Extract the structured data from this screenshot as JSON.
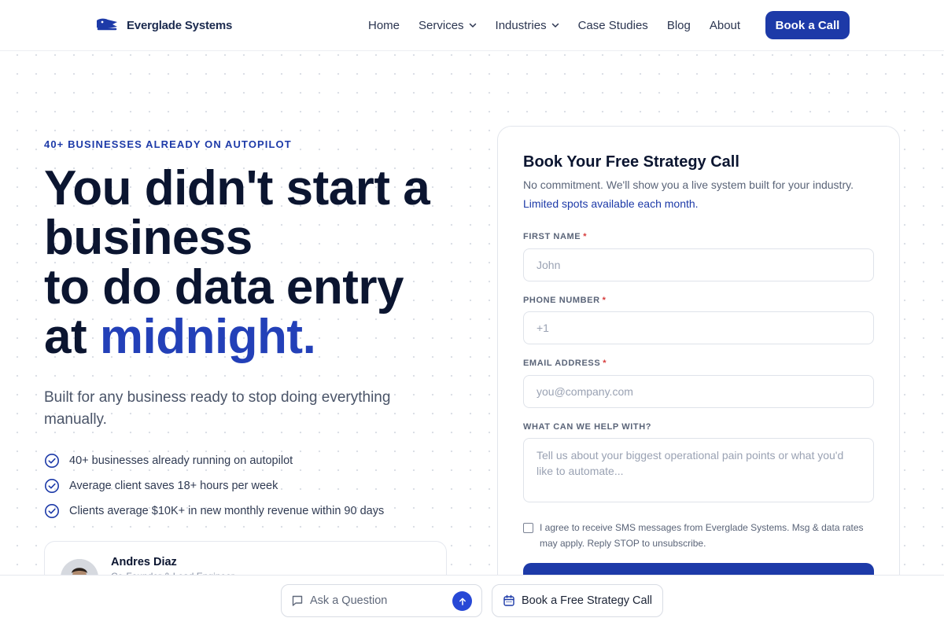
{
  "brand": {
    "name": "Everglade Systems",
    "logo_icon": "alligator-logo-icon",
    "accent": "#1d3aa8"
  },
  "nav": {
    "items": [
      {
        "label": "Home"
      },
      {
        "label": "Services",
        "icon": "chevron-down-icon"
      },
      {
        "label": "Industries",
        "icon": "chevron-down-icon"
      },
      {
        "label": "Case Studies"
      },
      {
        "label": "Blog"
      },
      {
        "label": "About"
      }
    ],
    "cta": "Book a Call"
  },
  "hero": {
    "eyebrow": "40+ BUSINESSES ALREADY ON AUTOPILOT",
    "headline_line1": "You didn't start a",
    "headline_line2": "business",
    "headline_line3": "to do data entry",
    "headline_line4_prefix": "at ",
    "headline_highlight": "midnight.",
    "subheadline": "Built for any business ready to stop doing everything manually.",
    "checks": [
      "40+ businesses already running on autopilot",
      "Average client saves 18+ hours per week",
      "Clients average $10K+ in new monthly revenue within 90 days"
    ]
  },
  "testimonial": {
    "name": "Andres Diaz",
    "role": "Co-Founder & Lead Engineer"
  },
  "form": {
    "title": "Book Your Free Strategy Call",
    "description": "No commitment. We'll show you a live system built for your industry.",
    "limited": "Limited spots available each month.",
    "first_name_label": "FIRST NAME",
    "first_name_placeholder": "John",
    "phone_label": "PHONE NUMBER",
    "phone_placeholder": "+1",
    "email_label": "EMAIL ADDRESS",
    "email_placeholder": "you@company.com",
    "help_label": "WHAT CAN WE HELP WITH?",
    "help_placeholder": "Tell us about your biggest operational pain points or what you'd like to automate...",
    "required_mark": "*",
    "consent_text": "I agree to receive SMS messages from Everglade Systems. Msg & data rates may apply. Reply STOP to unsubscribe."
  },
  "bottom_bar": {
    "ask_placeholder": "Ask a Question",
    "ask_icon": "chat-bubble-icon",
    "send_icon": "arrow-up-icon",
    "strategy_label": "Book a Free Strategy Call",
    "strategy_icon": "calendar-icon"
  }
}
